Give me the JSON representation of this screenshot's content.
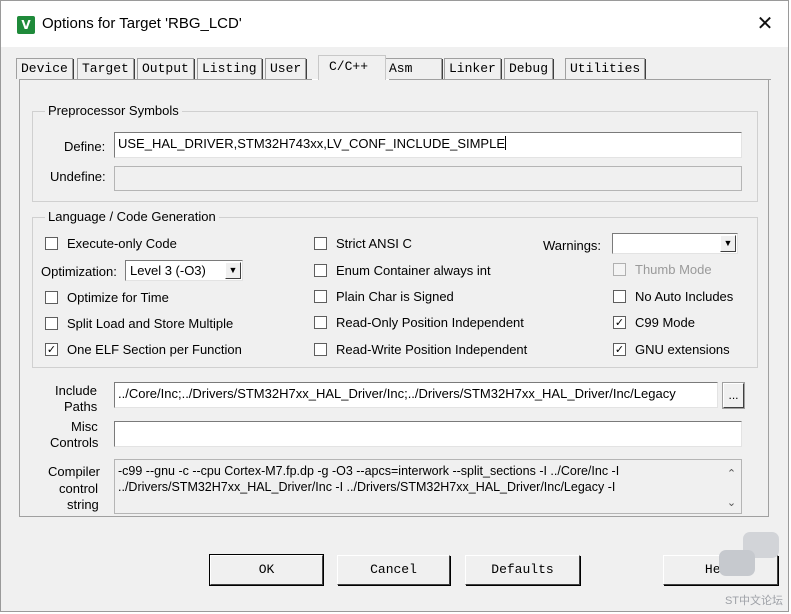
{
  "window": {
    "title": "Options for Target 'RBG_LCD'",
    "app_icon": "keil-uvision-icon",
    "close_glyph": "✕"
  },
  "tabs": [
    "Device",
    "Target",
    "Output",
    "Listing",
    "User",
    "C/C++",
    "Asm",
    "Linker",
    "Debug",
    "Utilities"
  ],
  "active_tab": "C/C++",
  "preprocessor": {
    "title": "Preprocessor Symbols",
    "define_label": "Define:",
    "define_value": "USE_HAL_DRIVER,STM32H743xx,LV_CONF_INCLUDE_SIMPLE",
    "undefine_label": "Undefine:",
    "undefine_value": ""
  },
  "codegen": {
    "title": "Language / Code Generation",
    "execute_only": {
      "label": "Execute-only Code",
      "checked": false
    },
    "optimization_label": "Optimization:",
    "optimization_value": "Level 3 (-O3)",
    "optimize_time": {
      "label": "Optimize for Time",
      "checked": false
    },
    "split_load": {
      "label": "Split Load and Store Multiple",
      "checked": false
    },
    "one_elf": {
      "label": "One ELF Section per Function",
      "checked": true
    },
    "strict_ansi": {
      "label": "Strict ANSI C",
      "checked": false
    },
    "enum_container": {
      "label": "Enum Container always int",
      "checked": false
    },
    "plain_char": {
      "label": "Plain Char is Signed",
      "checked": false
    },
    "ro_pi": {
      "label": "Read-Only Position Independent",
      "checked": false
    },
    "rw_pi": {
      "label": "Read-Write Position Independent",
      "checked": false
    },
    "warnings_label": "Warnings:",
    "warnings_value": "",
    "thumb_mode": {
      "label": "Thumb Mode",
      "checked": false,
      "disabled": true
    },
    "no_auto_includes": {
      "label": "No Auto Includes",
      "checked": false
    },
    "c99_mode": {
      "label": "C99 Mode",
      "checked": true
    },
    "gnu_ext": {
      "label": "GNU extensions",
      "checked": true
    }
  },
  "include_paths": {
    "label_line1": "Include",
    "label_line2": "Paths",
    "value": "../Core/Inc;../Drivers/STM32H7xx_HAL_Driver/Inc;../Drivers/STM32H7xx_HAL_Driver/Inc/Legacy",
    "browse_label": "..."
  },
  "misc_controls": {
    "label_line1": "Misc",
    "label_line2": "Controls",
    "value": ""
  },
  "compiler_string": {
    "label_line1": "Compiler",
    "label_line2": "control",
    "label_line3": "string",
    "line1": "-c99 --gnu -c --cpu Cortex-M7.fp.dp -g -O3 --apcs=interwork --split_sections -I ../Core/Inc -I",
    "line2": "../Drivers/STM32H7xx_HAL_Driver/Inc -I ../Drivers/STM32H7xx_HAL_Driver/Inc/Legacy -I"
  },
  "buttons": {
    "ok": "OK",
    "cancel": "Cancel",
    "defaults": "Defaults",
    "help": "Help"
  },
  "watermark": "ST中文论坛"
}
